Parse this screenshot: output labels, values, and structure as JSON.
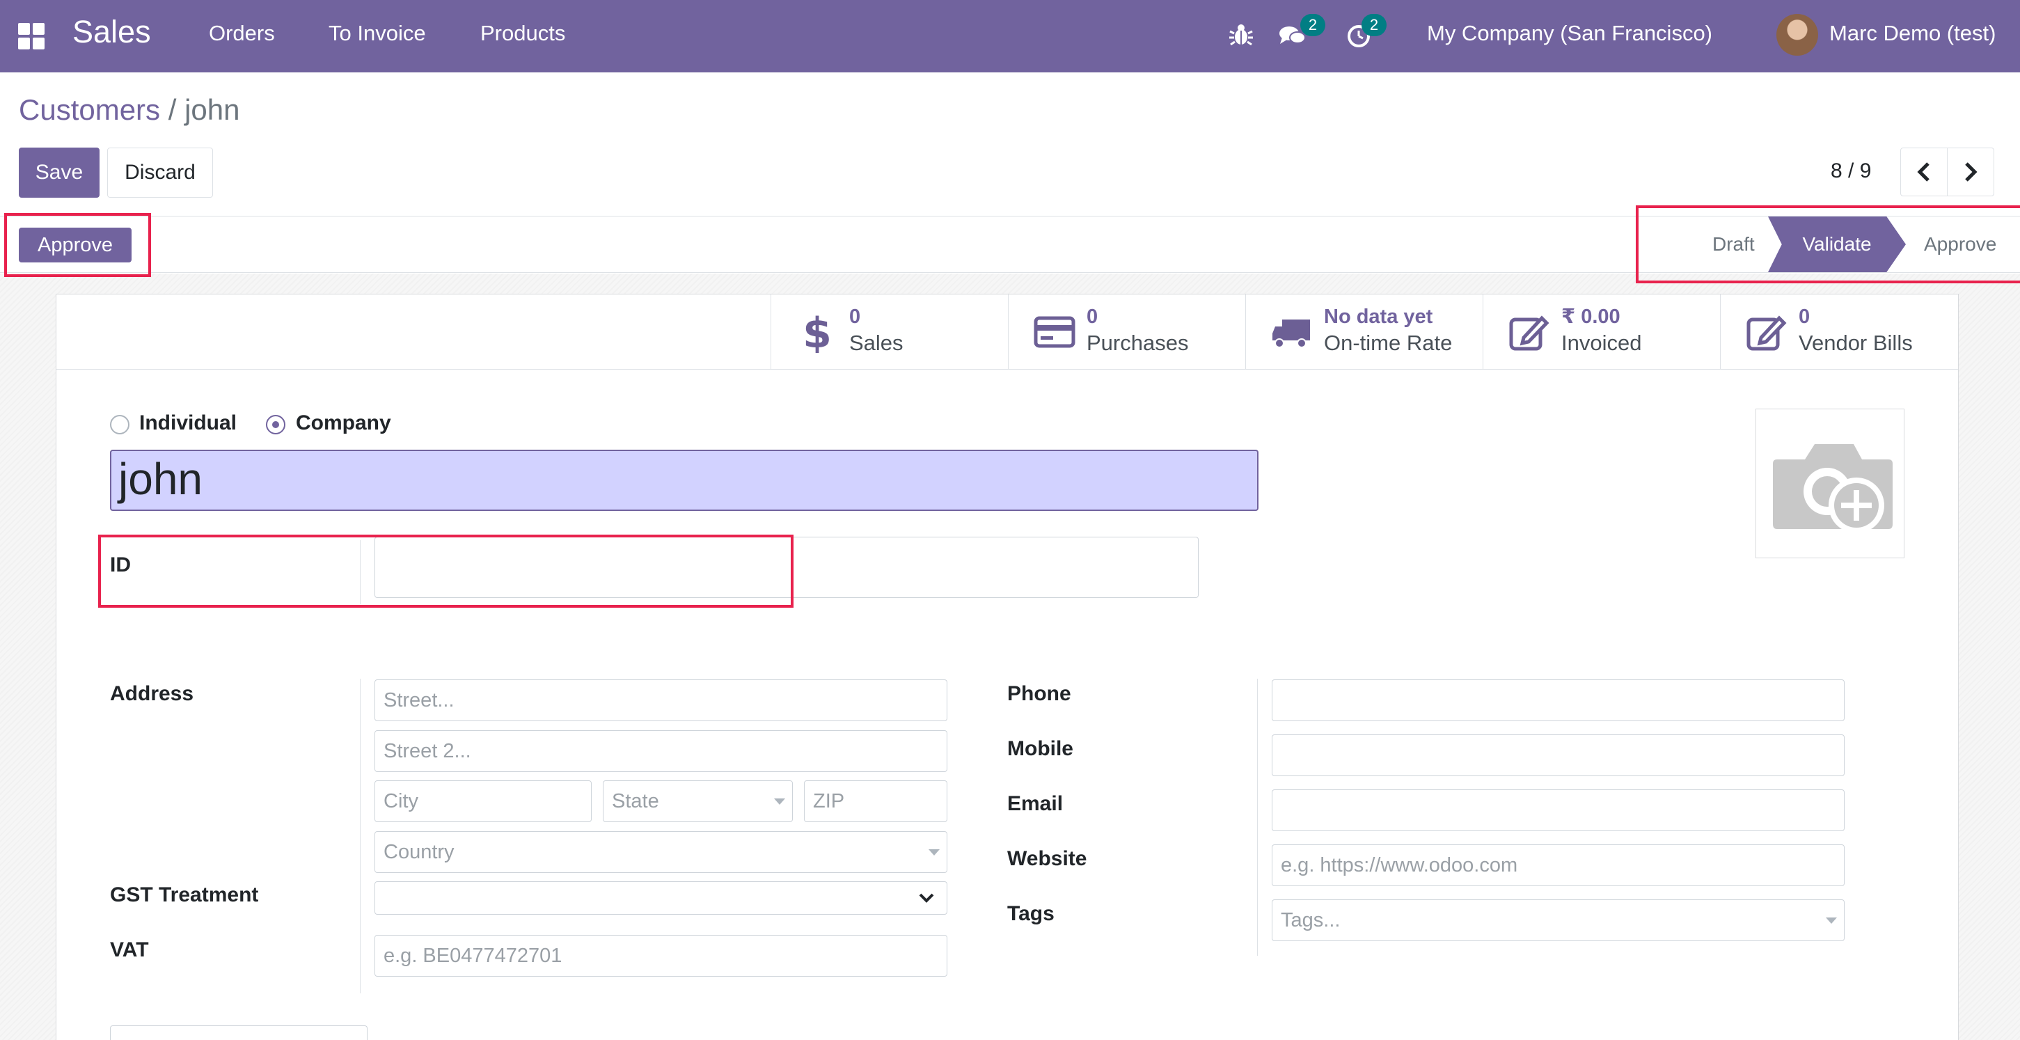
{
  "navbar": {
    "brand": "Sales",
    "menu": [
      "Orders",
      "To Invoice",
      "Products"
    ],
    "messages_badge": "2",
    "activities_badge": "2",
    "company": "My Company (San Francisco)",
    "user": "Marc Demo (test)",
    "color": "#71639e"
  },
  "breadcrumb": {
    "parent": "Customers",
    "separator": "/",
    "current": "john"
  },
  "actions": {
    "save": "Save",
    "discard": "Discard"
  },
  "pager": {
    "value": "8 / 9"
  },
  "header": {
    "approve_button": "Approve"
  },
  "statusbar": {
    "stages": [
      "Draft",
      "Validate",
      "Approve"
    ],
    "active": "Validate"
  },
  "smart_buttons": [
    {
      "value": "0",
      "label": "Sales",
      "icon": "dollar-icon"
    },
    {
      "value": "0",
      "label": "Purchases",
      "icon": "credit-card-icon"
    },
    {
      "value": "No data yet",
      "label": "On-time Rate",
      "icon": "truck-icon"
    },
    {
      "value": "₹ 0.00",
      "label": "Invoiced",
      "icon": "pencil-square-icon"
    },
    {
      "value": "0",
      "label": "Vendor Bills",
      "icon": "pencil-square-icon"
    }
  ],
  "company_type": {
    "individual": "Individual",
    "company": "Company",
    "selected": "Company"
  },
  "name": "john",
  "fields": {
    "id_label": "ID",
    "address_label": "Address",
    "street_placeholder": "Street...",
    "street2_placeholder": "Street 2...",
    "city_placeholder": "City",
    "state_placeholder": "State",
    "zip_placeholder": "ZIP",
    "country_placeholder": "Country",
    "gst_label": "GST Treatment",
    "vat_label": "VAT",
    "vat_placeholder": "e.g. BE0477472701",
    "phone_label": "Phone",
    "mobile_label": "Mobile",
    "email_label": "Email",
    "website_label": "Website",
    "website_placeholder": "e.g. https://www.odoo.com",
    "tags_label": "Tags",
    "tags_placeholder": "Tags..."
  }
}
